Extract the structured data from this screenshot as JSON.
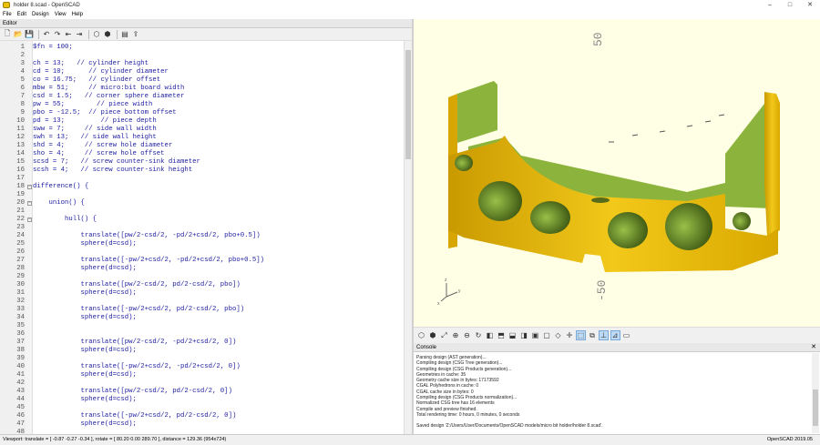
{
  "window": {
    "title": "holder 8.scad - OpenSCAD",
    "minimize": "–",
    "maximize": "□",
    "close": "✕"
  },
  "menu": [
    "File",
    "Edit",
    "Design",
    "View",
    "Help"
  ],
  "editor": {
    "title": "Editor",
    "lines": [
      {
        "n": "1",
        "t": "$fn = 100;"
      },
      {
        "n": "2",
        "t": ""
      },
      {
        "n": "3",
        "t": "ch = 13;   // cylinder height"
      },
      {
        "n": "4",
        "t": "cd = 10;      // cylinder diameter"
      },
      {
        "n": "5",
        "t": "co = 16.75;   // cylinder offset"
      },
      {
        "n": "6",
        "t": "mbw = 51;     // micro:bit board width"
      },
      {
        "n": "7",
        "t": "csd = 1.5;   // corner sphere diameter"
      },
      {
        "n": "8",
        "t": "pw = 55;        // piece width"
      },
      {
        "n": "9",
        "t": "pbo = -12.5;  // piece bottom offset"
      },
      {
        "n": "10",
        "t": "pd = 13;         // piece depth"
      },
      {
        "n": "11",
        "t": "sww = 7;     // side wall width"
      },
      {
        "n": "12",
        "t": "swh = 13;   // side wall height"
      },
      {
        "n": "13",
        "t": "shd = 4;     // screw hole diameter"
      },
      {
        "n": "14",
        "t": "sho = 4;     // screw hole offset"
      },
      {
        "n": "15",
        "t": "scsd = 7;   // screw counter-sink diameter"
      },
      {
        "n": "16",
        "t": "scsh = 4;   // screw counter-sink height"
      },
      {
        "n": "17",
        "t": ""
      },
      {
        "n": "18",
        "t": "difference() {"
      },
      {
        "n": "19",
        "t": ""
      },
      {
        "n": "20",
        "t": "    union() {"
      },
      {
        "n": "21",
        "t": ""
      },
      {
        "n": "22",
        "t": "        hull() {"
      },
      {
        "n": "23",
        "t": ""
      },
      {
        "n": "24",
        "t": "            translate([pw/2-csd/2, -pd/2+csd/2, pbo+0.5])"
      },
      {
        "n": "25",
        "t": "            sphere(d=csd);"
      },
      {
        "n": "26",
        "t": ""
      },
      {
        "n": "27",
        "t": "            translate([-pw/2+csd/2, -pd/2+csd/2, pbo+0.5])"
      },
      {
        "n": "28",
        "t": "            sphere(d=csd);"
      },
      {
        "n": "29",
        "t": ""
      },
      {
        "n": "30",
        "t": "            translate([pw/2-csd/2, pd/2-csd/2, pbo])"
      },
      {
        "n": "31",
        "t": "            sphere(d=csd);"
      },
      {
        "n": "32",
        "t": ""
      },
      {
        "n": "33",
        "t": "            translate([-pw/2+csd/2, pd/2-csd/2, pbo])"
      },
      {
        "n": "34",
        "t": "            sphere(d=csd);"
      },
      {
        "n": "35",
        "t": ""
      },
      {
        "n": "36",
        "t": ""
      },
      {
        "n": "37",
        "t": "            translate([pw/2-csd/2, -pd/2+csd/2, 0])"
      },
      {
        "n": "38",
        "t": "            sphere(d=csd);"
      },
      {
        "n": "39",
        "t": ""
      },
      {
        "n": "40",
        "t": "            translate([-pw/2+csd/2, -pd/2+csd/2, 0])"
      },
      {
        "n": "41",
        "t": "            sphere(d=csd);"
      },
      {
        "n": "42",
        "t": ""
      },
      {
        "n": "43",
        "t": "            translate([pw/2-csd/2, pd/2-csd/2, 0])"
      },
      {
        "n": "44",
        "t": "            sphere(d=csd);"
      },
      {
        "n": "45",
        "t": ""
      },
      {
        "n": "46",
        "t": "            translate([-pw/2+csd/2, pd/2-csd/2, 0])"
      },
      {
        "n": "47",
        "t": "            sphere(d=csd);"
      },
      {
        "n": "48",
        "t": ""
      }
    ]
  },
  "viewport": {
    "axis_top_label": "50",
    "axis_bottom_label": "-50",
    "axis_z": "z",
    "axis_y": "y",
    "axis_x": "x"
  },
  "console": {
    "title": "Console",
    "lines": [
      "Parsing design (AST generation)...",
      "Compiling design (CSG Tree generation)...",
      "Compiling design (CSG Products generation)...",
      "Geometries in cache: 35",
      "Geometry cache size in bytes: 17173592",
      "CGAL Polyhedrons in cache: 0",
      "CGAL cache size in bytes: 0",
      "Compiling design (CSG Products normalization)...",
      "Normalized CSG tree has 16 elements",
      "Compile and preview finished.",
      "Total rendering time: 0 hours, 0 minutes, 0 seconds",
      "",
      "Saved design 'Z:/Users/User/Documents/OpenSCAD models/micro bit holder/holder 8.scad'."
    ]
  },
  "status": {
    "viewport": "Viewport: translate = [ -0.87 -0.27 -0.34 ], rotate = [ 80.20 0.00 289.70 ], distance = 129.36 (954x724)",
    "version": "OpenSCAD 2019.05"
  },
  "colors": {
    "model_yellow": "#f2c81a",
    "model_green": "#8cb43c",
    "viewport_bg": "#ffffe5"
  }
}
